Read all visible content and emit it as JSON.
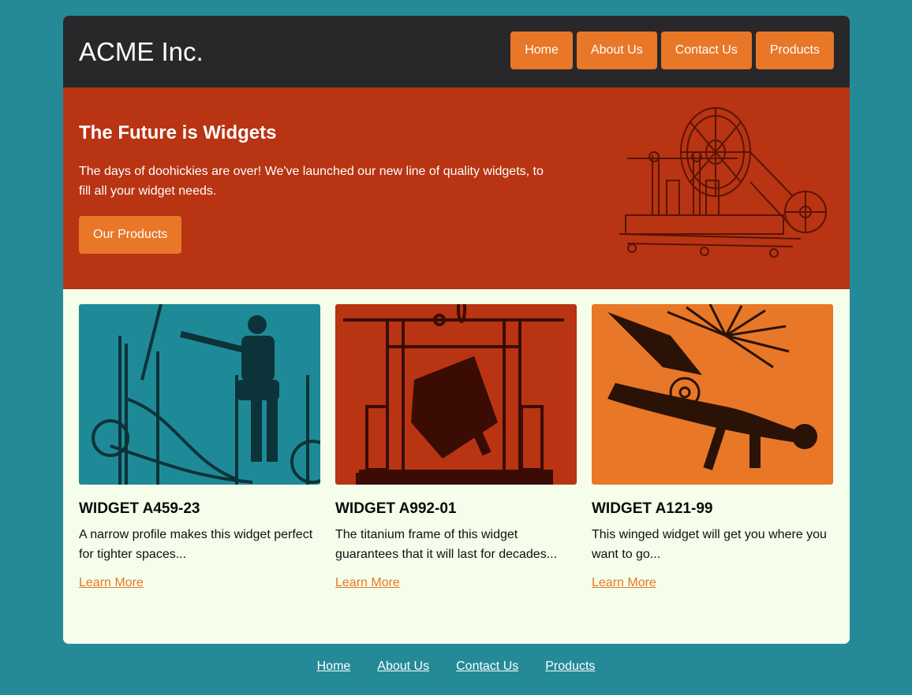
{
  "header": {
    "logo": "ACME Inc.",
    "nav": [
      "Home",
      "About Us",
      "Contact Us",
      "Products"
    ]
  },
  "hero": {
    "title": "The Future is Widgets",
    "text": "The days of doohickies are over! We've launched our new line of quality widgets, to fill all your widget needs.",
    "button": "Our Products"
  },
  "cards": [
    {
      "title": "WIDGET A459-23",
      "text": "A narrow profile makes this widget perfect for tighter spaces...",
      "link": "Learn More"
    },
    {
      "title": "WIDGET A992-01",
      "text": "The titanium frame of this widget guarantees that it will last for decades...",
      "link": "Learn More"
    },
    {
      "title": "WIDGET A121-99",
      "text": "This winged widget will get you where you want to go...",
      "link": "Learn More"
    }
  ],
  "footer": {
    "links": [
      "Home",
      "About Us",
      "Contact Us",
      "Products"
    ]
  },
  "colors": {
    "background": "#248a98",
    "header": "#28272a",
    "hero": "#b83412",
    "accent": "#e87728",
    "content": "#f4feea"
  }
}
